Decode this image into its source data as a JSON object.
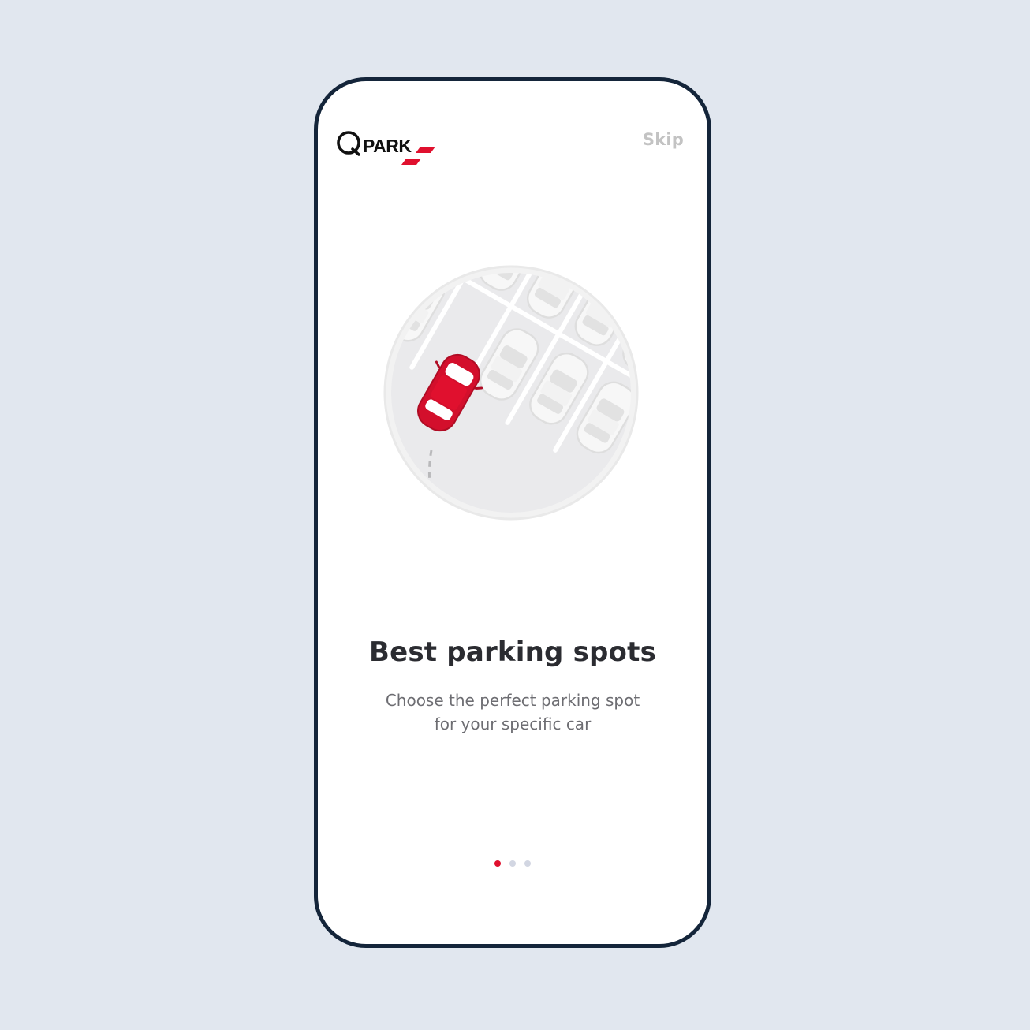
{
  "app": {
    "brand": "QPARK",
    "skip_label": "Skip"
  },
  "onboarding": {
    "illustration": "car-parking-icon",
    "title": "Best parking spots",
    "subtitle_lines": [
      "Choose the perfect parking spot",
      "for your specific car"
    ],
    "page_count": 3,
    "active_page": 1
  },
  "colors": {
    "background": "#e1e7ef",
    "phone_border": "#14253a",
    "accent_red": "#e0102e",
    "title": "#2b2c31",
    "subtitle": "#6d6d72",
    "skip": "#c3c3c3",
    "dot_inactive": "#d2d6e2"
  }
}
